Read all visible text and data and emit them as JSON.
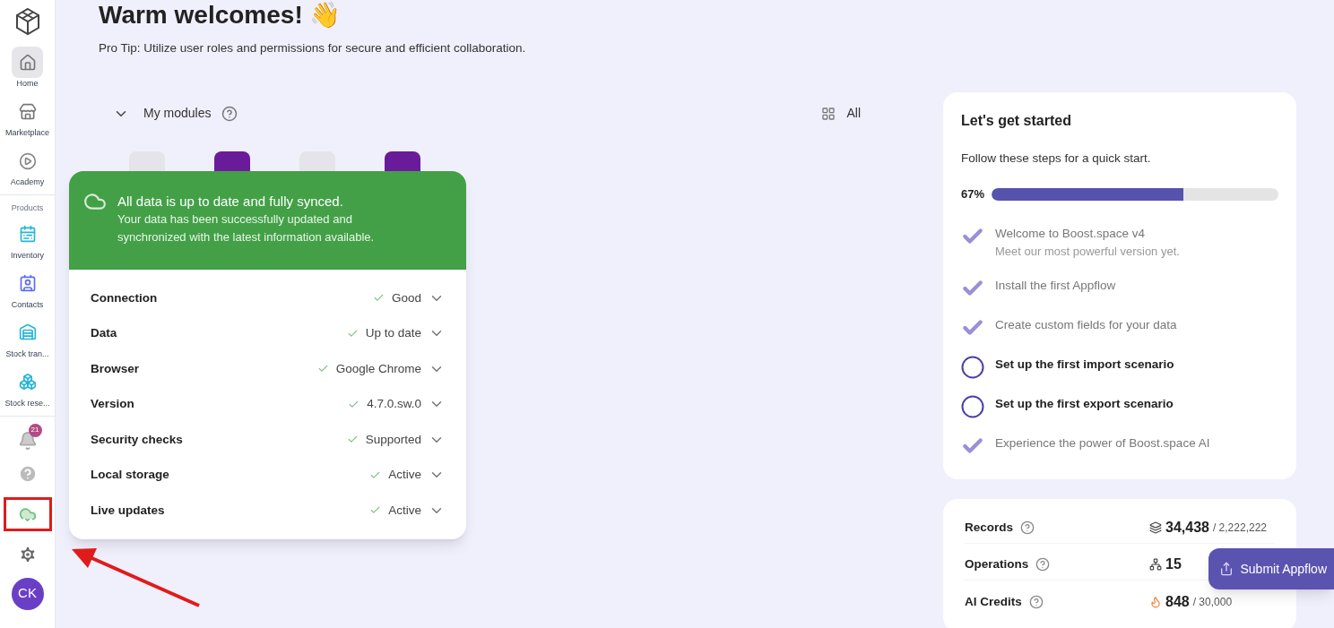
{
  "sidebar": {
    "items": [
      {
        "kind": "nav",
        "label": "Home",
        "selected": true
      },
      {
        "kind": "nav",
        "label": "Marketplace",
        "selected": false
      },
      {
        "kind": "nav",
        "label": "Academy",
        "selected": false
      },
      {
        "kind": "section",
        "label": "Products"
      },
      {
        "kind": "nav",
        "label": "Inventory",
        "selected": false
      },
      {
        "kind": "nav",
        "label": "Contacts",
        "selected": false
      },
      {
        "kind": "nav",
        "label": "Stock tran...",
        "selected": false
      },
      {
        "kind": "nav",
        "label": "Stock rese...",
        "selected": false
      }
    ],
    "notifications_badge": "21",
    "avatar": "CK"
  },
  "header": {
    "title": "Warm welcomes! 👋",
    "tip": "Pro Tip: Utilize user roles and permissions for secure and efficient collaboration."
  },
  "modules": {
    "title": "My modules",
    "filter": "All",
    "tiles": [
      {
        "color": "#e4e4ea"
      },
      {
        "color": "#6a1b9a"
      },
      {
        "color": "#e4e4ea"
      },
      {
        "color": "#6a1b9a"
      }
    ]
  },
  "sync_popover": {
    "title": "All data is up to date and fully synced.",
    "message": "Your data has been successfully updated and synchronized with the latest information available.",
    "rows": [
      {
        "label": "Connection",
        "value": "Good"
      },
      {
        "label": "Data",
        "value": "Up to date"
      },
      {
        "label": "Browser",
        "value": "Google Chrome"
      },
      {
        "label": "Version",
        "value": "4.7.0.sw.0"
      },
      {
        "label": "Security checks",
        "value": "Supported"
      },
      {
        "label": "Local storage",
        "value": "Active"
      },
      {
        "label": "Live updates",
        "value": "Active"
      }
    ]
  },
  "getting_started": {
    "title": "Let's get started",
    "subtitle": "Follow these steps for a quick start.",
    "percent": "67%",
    "level": 0.67,
    "steps": [
      {
        "title": "Welcome to Boost.space v4",
        "note": "Meet our most powerful version yet.",
        "done": true
      },
      {
        "title": "Install the first Appflow",
        "done": true
      },
      {
        "title": "Create custom fields for your data",
        "done": true
      },
      {
        "title": "Set up the first import scenario",
        "done": false
      },
      {
        "title": "Set up the first export scenario",
        "done": false
      },
      {
        "title": "Experience the power of Boost.space AI",
        "done": true
      }
    ]
  },
  "usage": [
    {
      "label": "Records",
      "value": "34,438",
      "limit": "/ 2,222,222"
    },
    {
      "label": "Operations",
      "value": "15"
    },
    {
      "label": "AI Credits",
      "value": "848",
      "limit": "/ 30,000"
    }
  ],
  "submit_button": "Submit Appflow"
}
